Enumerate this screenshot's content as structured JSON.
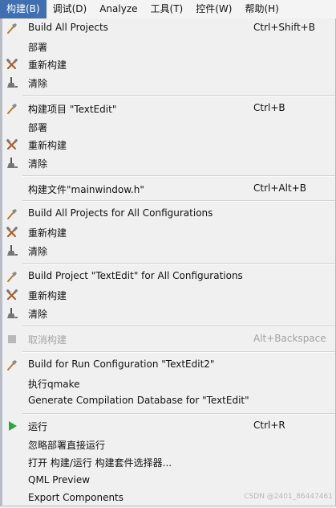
{
  "menubar": {
    "items": [
      "构建(B)",
      "调试(D)",
      "Analyze",
      "工具(T)",
      "控件(W)",
      "帮助(H)"
    ]
  },
  "menu": {
    "build_all": "Build All Projects",
    "build_all_shortcut": "Ctrl+Shift+B",
    "deploy": "部署",
    "rebuild": "重新构建",
    "clean": "清除",
    "build_project": "构建项目 \"TextEdit\"",
    "build_project_shortcut": "Ctrl+B",
    "build_file": "构建文件\"mainwindow.h\"",
    "build_file_shortcut": "Ctrl+Alt+B",
    "build_all_configs": "Build All Projects for All Configurations",
    "build_project_configs": "Build Project \"TextEdit\" for All Configurations",
    "cancel_build": "取消构建",
    "cancel_build_shortcut": "Alt+Backspace",
    "build_run_config": "Build for Run Configuration \"TextEdit2\"",
    "run_qmake": "执行qmake",
    "compilation_db": "Generate Compilation Database for \"TextEdit\"",
    "run": "运行",
    "run_shortcut": "Ctrl+R",
    "run_no_deploy": "忽略部署直接运行",
    "open_kit_selector": "打开 构建/运行 构建套件选择器...",
    "qml_preview": "QML Preview",
    "export_components": "Export Components"
  },
  "watermark": "CSDN @2401_86447461",
  "icons": {
    "build": "hammer-icon",
    "rebuild": "rebuild-icon",
    "clean": "clean-icon",
    "cancel": "stop-icon",
    "run": "run-icon"
  },
  "colors": {
    "active_menu_bg": "#3f6fb1",
    "run_green": "#2aa839",
    "disabled_text": "#a3a3a3"
  }
}
